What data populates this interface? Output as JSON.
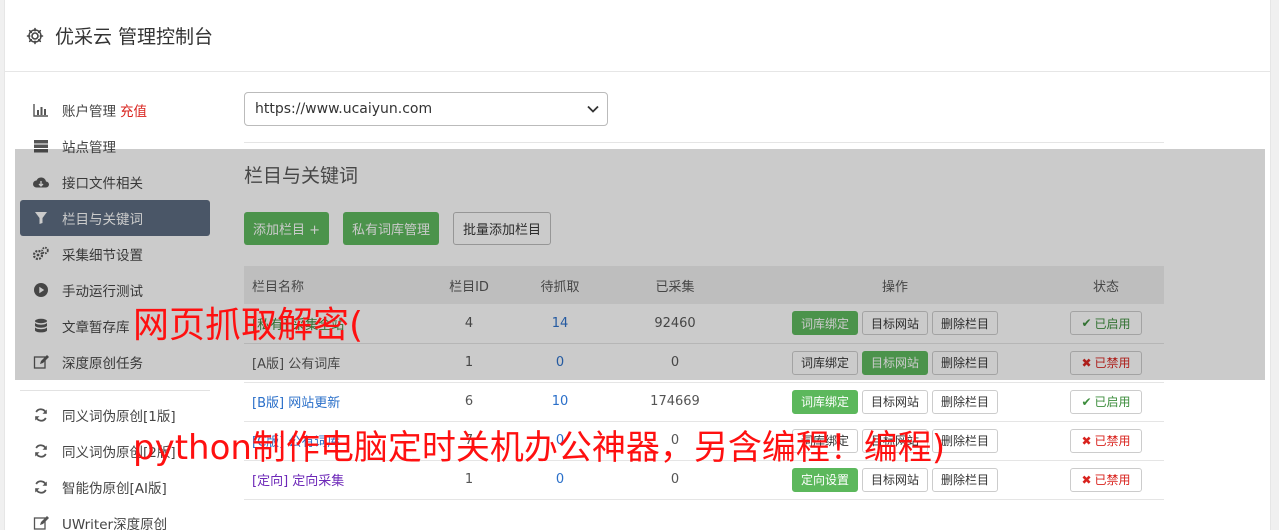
{
  "header": {
    "title": "优采云 管理控制台"
  },
  "sidebar": {
    "items": [
      {
        "label": "账户管理",
        "extra": "充值",
        "icon": "bar-chart-icon"
      },
      {
        "label": "站点管理",
        "icon": "server-icon"
      },
      {
        "label": "接口文件相关",
        "icon": "cloud-download-icon"
      },
      {
        "label": "栏目与关键词",
        "icon": "filter-icon"
      },
      {
        "label": "采集细节设置",
        "icon": "gears-icon"
      },
      {
        "label": "手动运行测试",
        "icon": "play-circle-icon"
      },
      {
        "label": "文章暂存库",
        "icon": "database-icon"
      },
      {
        "label": "深度原创任务",
        "icon": "edit-icon"
      }
    ],
    "tools": [
      {
        "label": "同义词伪原创[1版]",
        "icon": "refresh-icon"
      },
      {
        "label": "同义词伪原创[2版]",
        "icon": "refresh-icon"
      },
      {
        "label": "智能伪原创[AI版]",
        "icon": "refresh-icon"
      },
      {
        "label": "UWriter深度原创",
        "icon": "edit-icon"
      }
    ]
  },
  "main": {
    "site_select": "https://www.ucaiyun.com",
    "section_title": "栏目与关键词",
    "buttons": {
      "add": "添加栏目 +",
      "private": "私有词库管理",
      "batch": "批量添加栏目"
    },
    "table": {
      "headers": [
        "栏目名称",
        "栏目ID",
        "待抓取",
        "已采集",
        "操作",
        "状态"
      ],
      "rows": [
        {
          "tag": "[私有]",
          "name": "采集全站",
          "id": "4",
          "pending": "14",
          "collected": "92460",
          "op1": "词库绑定",
          "op2": "目标网站",
          "op3": "删除栏目",
          "status": "已启用"
        },
        {
          "tag": "[A版]",
          "name": "公有词库",
          "id": "1",
          "pending": "0",
          "collected": "0",
          "op1": "词库绑定",
          "op2": "目标网站",
          "op3": "删除栏目",
          "status": "已禁用"
        },
        {
          "tag": "[B版]",
          "name": "网站更新",
          "id": "6",
          "pending": "10",
          "collected": "174669",
          "op1": "词库绑定",
          "op2": "目标网站",
          "op3": "删除栏目",
          "status": "已启用"
        },
        {
          "tag": "[C版]",
          "name": "公有词库",
          "id": "7",
          "pending": "0",
          "collected": "0",
          "op1": "词库绑定",
          "op2": "目标网站",
          "op3": "删除栏目",
          "status": "已禁用"
        },
        {
          "tag": "[定向]",
          "name": "定向采集",
          "id": "1",
          "pending": "0",
          "collected": "0",
          "op1": "定向设置",
          "op2": "目标网站",
          "op3": "删除栏目",
          "status": "已禁用"
        }
      ]
    }
  },
  "watermark": {
    "line1": "网页抓取解密(",
    "line2": "python制作电脑定时关机办公神器，另含编程！编程)"
  }
}
